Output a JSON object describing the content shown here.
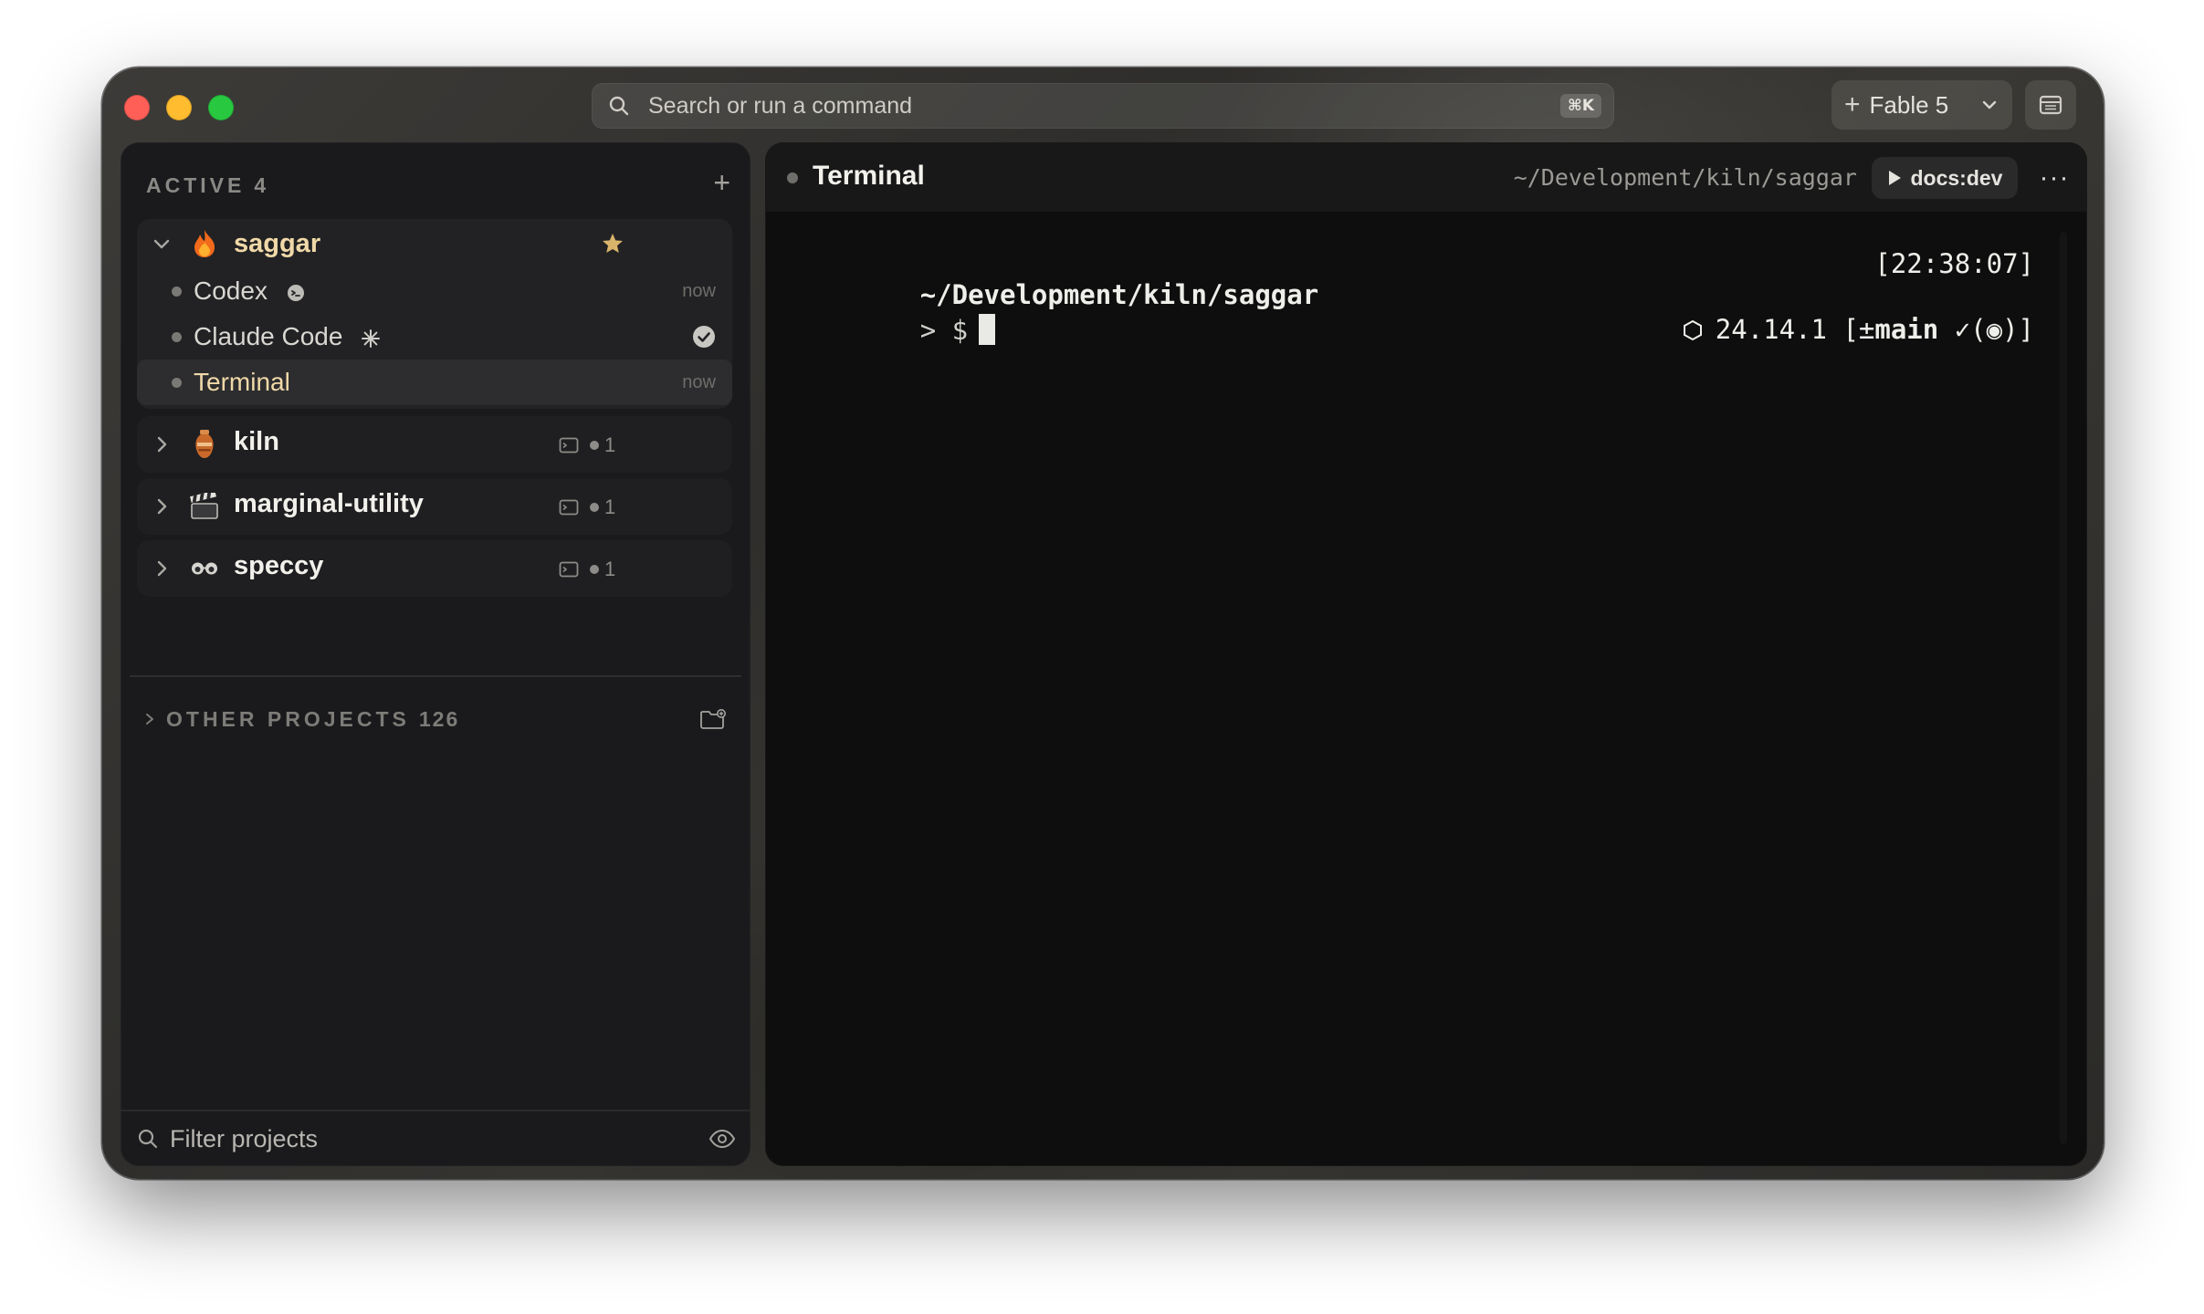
{
  "command_bar": {
    "placeholder": "Search or run a command",
    "shortcut": "⌘K"
  },
  "profile": {
    "label": "Fable 5"
  },
  "sidebar": {
    "section_title": "ACTIVE",
    "section_count": "4",
    "projects": [
      {
        "name": "saggar",
        "emoji": "fire-icon",
        "expanded": true,
        "starred": true,
        "sessions": [
          {
            "label": "Codex",
            "time": "now",
            "badge": "codex-icon"
          },
          {
            "label": "Claude Code",
            "badge": "claude-icon",
            "status": "done"
          },
          {
            "label": "Terminal",
            "time": "now",
            "selected": true
          }
        ]
      },
      {
        "name": "kiln",
        "emoji": "vase-icon",
        "sessions_count": "1"
      },
      {
        "name": "marginal-utility",
        "emoji": "clapper-icon",
        "sessions_count": "1"
      },
      {
        "name": "speccy",
        "emoji": "glasses-icon",
        "sessions_count": "1"
      }
    ],
    "other_projects": {
      "title": "OTHER PROJECTS",
      "count": "126"
    },
    "filter": {
      "placeholder": "Filter projects",
      "value": ""
    }
  },
  "terminal": {
    "title": "Terminal",
    "path": "~/Development/kiln/saggar",
    "run_label": "docs:dev",
    "more_label": "···",
    "lines": {
      "cwd": "~/Development/kiln/saggar",
      "timestamp": "[22:38:07]",
      "prompt": "> $",
      "node_version": "24.14.1",
      "git_open": "[±",
      "git_branch": "main",
      "git_status": " ✓(◉)]"
    }
  },
  "colors": {
    "accent_gold": "#f0d9a8",
    "star": "#d9b46a",
    "close": "#ff5f57",
    "minimize": "#febc2e",
    "zoom": "#28c840"
  }
}
